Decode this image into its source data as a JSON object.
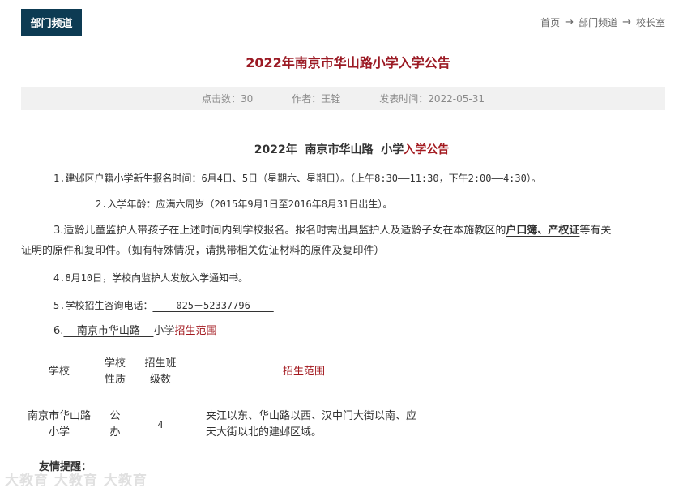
{
  "header": {
    "section_tag": "部门频道",
    "breadcrumb": [
      "首页",
      "部门频道",
      "校长室"
    ],
    "breadcrumb_sep": "→"
  },
  "article": {
    "title": "2022年南京市华山路小学入学公告",
    "meta": {
      "clicks": "点击数：30",
      "author": "作者：王铨",
      "date": "发表时间：2022-05-31"
    },
    "subhead": {
      "year": "2022年",
      "school": "  南京市华山路  ",
      "mid": "小学",
      "tail": "入学公告"
    },
    "p1": "1.建邺区户籍小学新生报名时间：6月4日、5日（星期六、星期日）。（上午8:30——11:30，下午2:00——4:30）。",
    "p2": "2.入学年龄：应满六周岁（2015年9月1日至2016年8月31日出生）。",
    "p3_a": "3.适龄儿童监护人带孩子在上述时间内到学校报名。报名时需出具监护人及适龄子女在本施教区的",
    "p3_b": "户口簿、产权证",
    "p3_c": "等有关",
    "p3_d": "证明的原件和复印件。（如有特殊情况，请携带相关佐证材料的原件及复印件）",
    "p4": "4.8月10日，学校向监护人发放入学通知书。",
    "p5_label": "5.学校招生咨询电话：",
    "p5_phone": "    025－52337796    ",
    "p6_num": "6.",
    "p6_school": "    南京市华山路    ",
    "p6_mid": "小学",
    "p6_tail": "招生范围",
    "table": {
      "headers": [
        "学校",
        "学校性质",
        "招生班级数",
        "招生范围"
      ],
      "row": [
        "南京市华山路小学",
        "公办",
        "4",
        "夹江以东、华山路以西、汉中门大街以南、应天大街以北的建邺区域。"
      ]
    },
    "tip": "友情提醒："
  },
  "watermark": "大教育 大教育 大教育"
}
